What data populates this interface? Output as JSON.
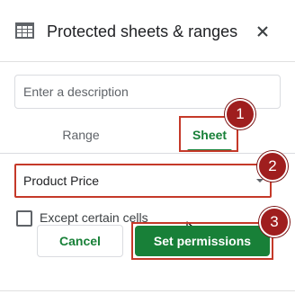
{
  "header": {
    "title": "Protected sheets & ranges",
    "icon": "sheets-grid-icon",
    "close_icon": "close-icon"
  },
  "description": {
    "placeholder": "Enter a description",
    "value": ""
  },
  "tabs": [
    {
      "label": "Range",
      "active": false
    },
    {
      "label": "Sheet",
      "active": true
    }
  ],
  "sheet_select": {
    "value": "Product Price",
    "icon": "dropdown-arrow-icon"
  },
  "except_cells": {
    "label": "Except certain cells",
    "checked": false
  },
  "buttons": {
    "cancel_label": "Cancel",
    "set_permissions_label": "Set permissions"
  },
  "annotations": {
    "badge_1": "1",
    "badge_2": "2",
    "badge_3": "3"
  },
  "colors": {
    "accent_green": "#188038",
    "highlight_red": "#c53929",
    "badge_red": "#9f1e1e"
  }
}
